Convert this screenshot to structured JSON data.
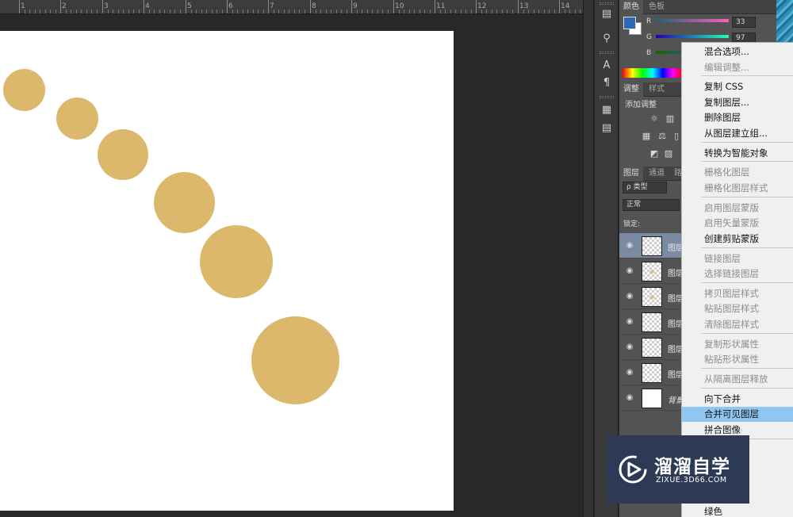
{
  "ruler": {
    "labels": [
      "1",
      "2",
      "3",
      "4",
      "5",
      "6",
      "7",
      "8",
      "9",
      "10",
      "11",
      "12",
      "13",
      "14"
    ]
  },
  "canvas": {
    "circle_color": "#dbb86b"
  },
  "toolstrip": {
    "icons": [
      "brush-presets-icon",
      "clone-source-icon",
      "character-icon",
      "paragraph-icon",
      "properties-icon",
      "notes-icon"
    ]
  },
  "color_panel": {
    "tabs": [
      "颜色",
      "色板"
    ],
    "foreground": "#2a6bb3",
    "channels": [
      {
        "label": "R",
        "value": "33"
      },
      {
        "label": "G",
        "value": "97"
      },
      {
        "label": "B",
        "value": ""
      }
    ]
  },
  "adjustments_panel": {
    "tabs": [
      "调整",
      "样式"
    ],
    "title": "添加调整"
  },
  "layers_panel": {
    "tabs": [
      "图层",
      "通道",
      "路"
    ],
    "filter_label": "ρ 类型",
    "blend_mode": "正常",
    "lock_label": "锁定:",
    "layers": [
      {
        "name": "图层",
        "selected": true
      },
      {
        "name": "图层",
        "selected": false
      },
      {
        "name": "图层",
        "selected": false
      },
      {
        "name": "图层",
        "selected": false
      },
      {
        "name": "图层",
        "selected": false
      },
      {
        "name": "图层",
        "selected": false
      },
      {
        "name": "背景",
        "selected": false
      }
    ]
  },
  "context_menu": {
    "items": [
      {
        "label": "混合选项...",
        "disabled": false
      },
      {
        "label": "编辑调整...",
        "disabled": true
      },
      {
        "label": "复制 CSS",
        "disabled": false
      },
      {
        "label": "复制图层...",
        "disabled": false
      },
      {
        "label": "删除图层",
        "disabled": false
      },
      {
        "label": "从图层建立组...",
        "disabled": false
      },
      {
        "label": "转换为智能对象",
        "disabled": false
      },
      {
        "label": "栅格化图层",
        "disabled": true
      },
      {
        "label": "栅格化图层样式",
        "disabled": true
      },
      {
        "label": "启用图层蒙版",
        "disabled": true
      },
      {
        "label": "启用矢量蒙版",
        "disabled": true
      },
      {
        "label": "创建剪贴蒙版",
        "disabled": false
      },
      {
        "label": "链接图层",
        "disabled": true
      },
      {
        "label": "选择链接图层",
        "disabled": true
      },
      {
        "label": "拷贝图层样式",
        "disabled": true
      },
      {
        "label": "粘贴图层样式",
        "disabled": true
      },
      {
        "label": "清除图层样式",
        "disabled": true
      },
      {
        "label": "复制形状属性",
        "disabled": true
      },
      {
        "label": "粘贴形状属性",
        "disabled": true
      },
      {
        "label": "从隔离图层释放",
        "disabled": true
      },
      {
        "label": "向下合并",
        "disabled": false
      },
      {
        "label": "合并可见图层",
        "disabled": false,
        "highlighted": true
      },
      {
        "label": "拼合图像",
        "disabled": false
      },
      {
        "label": "绿色",
        "disabled": false
      }
    ]
  },
  "watermark": {
    "title": "溜溜自学",
    "url": "ZIXUE.3D66.COM"
  }
}
